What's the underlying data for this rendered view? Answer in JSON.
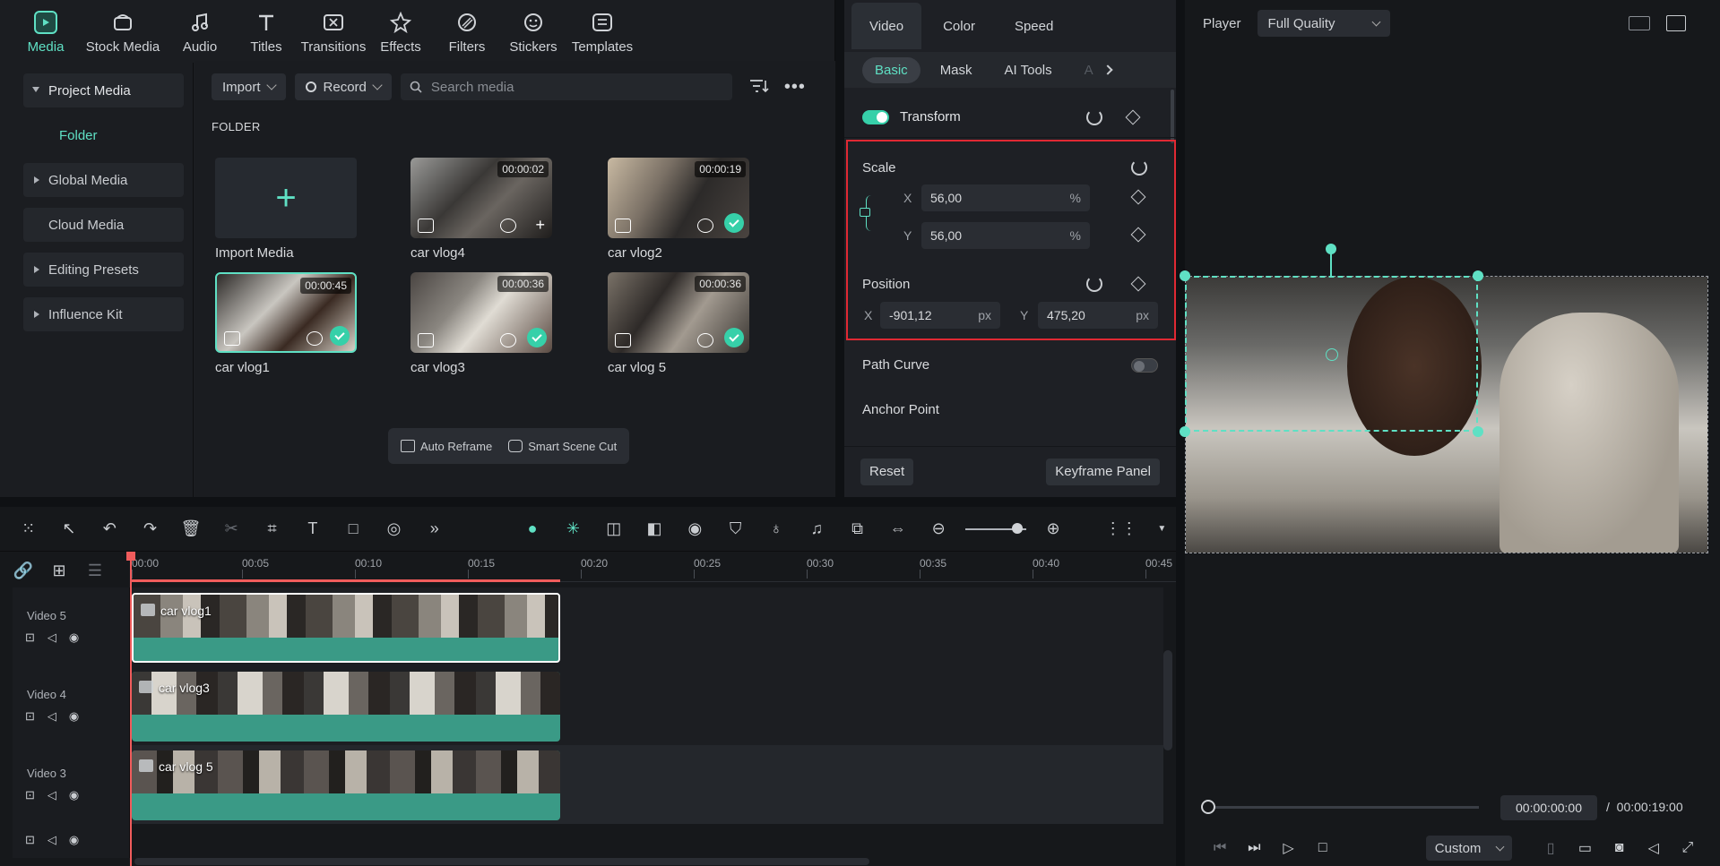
{
  "media": {
    "tabs": [
      {
        "label": "Media",
        "icon": "media-icon",
        "active": true
      },
      {
        "label": "Stock Media",
        "icon": "stock-media-icon"
      },
      {
        "label": "Audio",
        "icon": "audio-icon"
      },
      {
        "label": "Titles",
        "icon": "titles-icon"
      },
      {
        "label": "Transitions",
        "icon": "transitions-icon"
      },
      {
        "label": "Effects",
        "icon": "effects-icon"
      },
      {
        "label": "Filters",
        "icon": "filters-icon"
      },
      {
        "label": "Stickers",
        "icon": "stickers-icon"
      },
      {
        "label": "Templates",
        "icon": "templates-icon"
      }
    ],
    "sidebar": {
      "items": [
        {
          "label": "Project Media"
        },
        {
          "label": "Folder"
        },
        {
          "label": "Global Media"
        },
        {
          "label": "Cloud Media"
        },
        {
          "label": "Editing Presets"
        },
        {
          "label": "Influence Kit"
        }
      ]
    },
    "toolbar": {
      "import_label": "Import",
      "record_label": "Record",
      "search_placeholder": "Search media"
    },
    "folder_label": "FOLDER",
    "import_tile_label": "Import Media",
    "clips": [
      {
        "name": "car vlog4",
        "duration": "00:00:02"
      },
      {
        "name": "car vlog2",
        "duration": "00:00:19"
      },
      {
        "name": "car vlog1",
        "duration": "00:00:45"
      },
      {
        "name": "car vlog3",
        "duration": "00:00:36"
      },
      {
        "name": "car vlog 5",
        "duration": "00:00:36"
      }
    ],
    "reframe_bar": {
      "auto_reframe": "Auto Reframe",
      "smart_scene_cut": "Smart Scene Cut"
    }
  },
  "props": {
    "tabs": [
      "Video",
      "Color",
      "Speed"
    ],
    "sub_tabs": [
      "Basic",
      "Mask",
      "AI Tools",
      "A"
    ],
    "transform_label": "Transform",
    "scale": {
      "label": "Scale",
      "x_label": "X",
      "y_label": "Y",
      "x": "56,00",
      "y": "56,00",
      "unit": "%"
    },
    "position": {
      "label": "Position",
      "x_label": "X",
      "y_label": "Y",
      "x": "-901,12",
      "y": "475,20",
      "unit": "px"
    },
    "path_curve_label": "Path Curve",
    "anchor_point_label": "Anchor Point",
    "reset_label": "Reset",
    "keyframe_panel_label": "Keyframe Panel"
  },
  "player": {
    "label": "Player",
    "quality": "Full Quality",
    "current_time": "00:00:00:00",
    "separator": "/",
    "total_time": "00:00:19:00",
    "custom_label": "Custom"
  },
  "timeline": {
    "ruler": [
      "00:00",
      "00:05",
      "00:10",
      "00:15",
      "00:20",
      "00:25",
      "00:30",
      "00:35",
      "00:40",
      "00:45"
    ],
    "tracks": [
      {
        "name": "Video 5",
        "clip": "car vlog1"
      },
      {
        "name": "Video 4",
        "clip": "car vlog3"
      },
      {
        "name": "Video 3",
        "clip": "car vlog 5"
      }
    ]
  },
  "colors": {
    "accent": "#5fe0c4",
    "highlight": "#e02933",
    "playhead": "#f05c5c"
  }
}
